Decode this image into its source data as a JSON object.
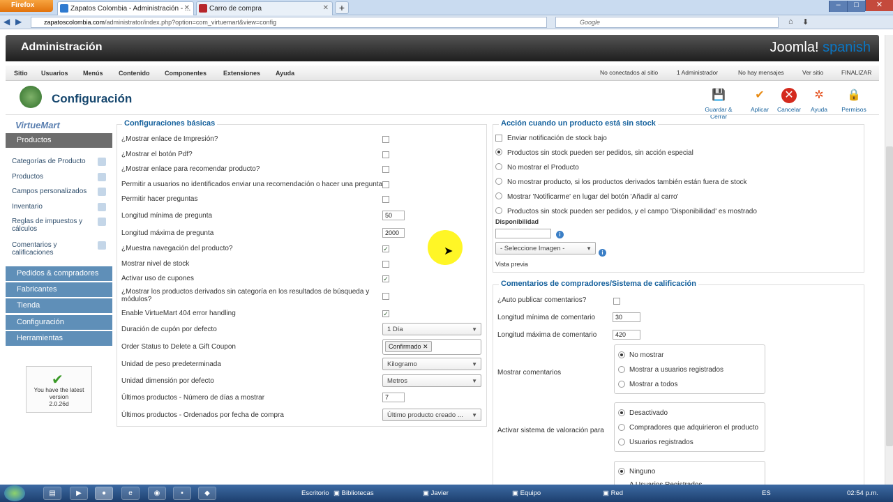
{
  "browser": {
    "ff_button": "Firefox",
    "tabs": [
      {
        "label": "Zapatos Colombia - Administración - ..."
      },
      {
        "label": "Carro de compra"
      }
    ],
    "url_domain": "zapatoscolombia.com",
    "url_path": "/administrator/index.php?option=com_virtuemart&view=config",
    "search_placeholder": "Google"
  },
  "header": {
    "title": "Administración",
    "logo_a": "Joomla!",
    "logo_b": "spanish"
  },
  "menu": {
    "items": [
      "Sitio",
      "Usuarios",
      "Menús",
      "Contenido",
      "Componentes",
      "Extensiones",
      "Ayuda"
    ],
    "status": [
      "No conectados al sitio",
      "1 Administrador",
      "No hay mensajes",
      "Ver sitio",
      "FINALIZAR"
    ]
  },
  "toolbar": {
    "title": "Configuración",
    "buttons": [
      "Guardar & Cerrar",
      "Aplicar",
      "Cancelar",
      "Ayuda",
      "Permisos"
    ]
  },
  "sidebar": {
    "logo": "VirtueMart",
    "section_products": "Productos",
    "items": [
      "Categorías de Producto",
      "Productos",
      "Campos personalizados",
      "Inventario",
      "Reglas de impuestos y",
      "cálculos",
      "Comentarios y",
      "calificaciones"
    ],
    "sections": [
      "Pedidos & compradores",
      "Fabricantes",
      "Tienda",
      "Configuración",
      "Herramientas"
    ],
    "latest": [
      "You have the latest",
      "version",
      "2.0.26d"
    ]
  },
  "basic": {
    "title": "Configuraciones básicas",
    "rows": [
      "¿Mostrar enlace de Impresión?",
      "¿Mostrar el botón Pdf?",
      "¿Mostrar enlace para recomendar producto?",
      "Permitir a usuarios no identificados enviar una recomendación o hacer una pregunta",
      "Permitir hacer preguntas",
      "Longitud mínima de pregunta",
      "Longitud máxima de pregunta",
      "¿Muestra navegación del producto?",
      "Mostrar nivel de stock",
      "Activar uso de cupones",
      "¿Mostrar los productos derivados sin categoría en los resultados de búsqueda y",
      "módulos?",
      "Enable VirtueMart 404 error handling",
      "Duración de cupón por defecto",
      "Order Status to Delete a Gift Coupon",
      "Unidad de peso predeterminada",
      "Unidad dimensión por defecto",
      "Últimos productos - Número de días a mostrar",
      "Últimos productos - Ordenados por fecha de compra"
    ],
    "min_q": "50",
    "max_q": "2000",
    "coupon_duration": "1 Día",
    "gift_status": "Confirmado",
    "weight_unit": "Kilogramo",
    "dim_unit": "Metros",
    "latest_days": "7",
    "latest_order": "Último producto creado ..."
  },
  "stock": {
    "title": "Acción cuando un producto está sin stock",
    "notify": "Enviar notificación de stock bajo",
    "options": [
      "Productos sin stock pueden ser pedidos, sin acción especial",
      "No mostrar el Producto",
      "No mostrar producto, si los productos derivados también están fuera de stock",
      "Mostrar 'Notificarme' en lugar del botón 'Añadir al carro'",
      "Productos sin stock pueden ser pedidos, y el campo 'Disponibilidad' es mostrado"
    ],
    "avail_label": "Disponibilidad",
    "image_select": "- Seleccione Imagen -",
    "preview": "Vista previa"
  },
  "reviews": {
    "title": "Comentarios de compradores/Sistema de calificación",
    "auto_publish": "¿Auto publicar comentarios?",
    "min_len_label": "Longitud mínima de comentario",
    "min_len": "30",
    "max_len_label": "Longitud máxima de comentario",
    "max_len": "420",
    "show_label": "Mostrar comentarios",
    "show_opts": [
      "No mostrar",
      "Mostrar a usuarios registrados",
      "Mostrar a todos"
    ],
    "rating_label": "Activar sistema de valoración para",
    "rating_opts": [
      "Desactivado",
      "Compradores que adquirieron el producto",
      "Usuarios registrados"
    ],
    "third_opts": [
      "Ninguno",
      "A Usuarios Registrados"
    ]
  },
  "taskbar": {
    "items": [
      "Escritorio",
      "Bibliotecas",
      "Javier",
      "Equipo",
      "Red"
    ],
    "lang": "ES",
    "time": "02:54 p.m."
  }
}
